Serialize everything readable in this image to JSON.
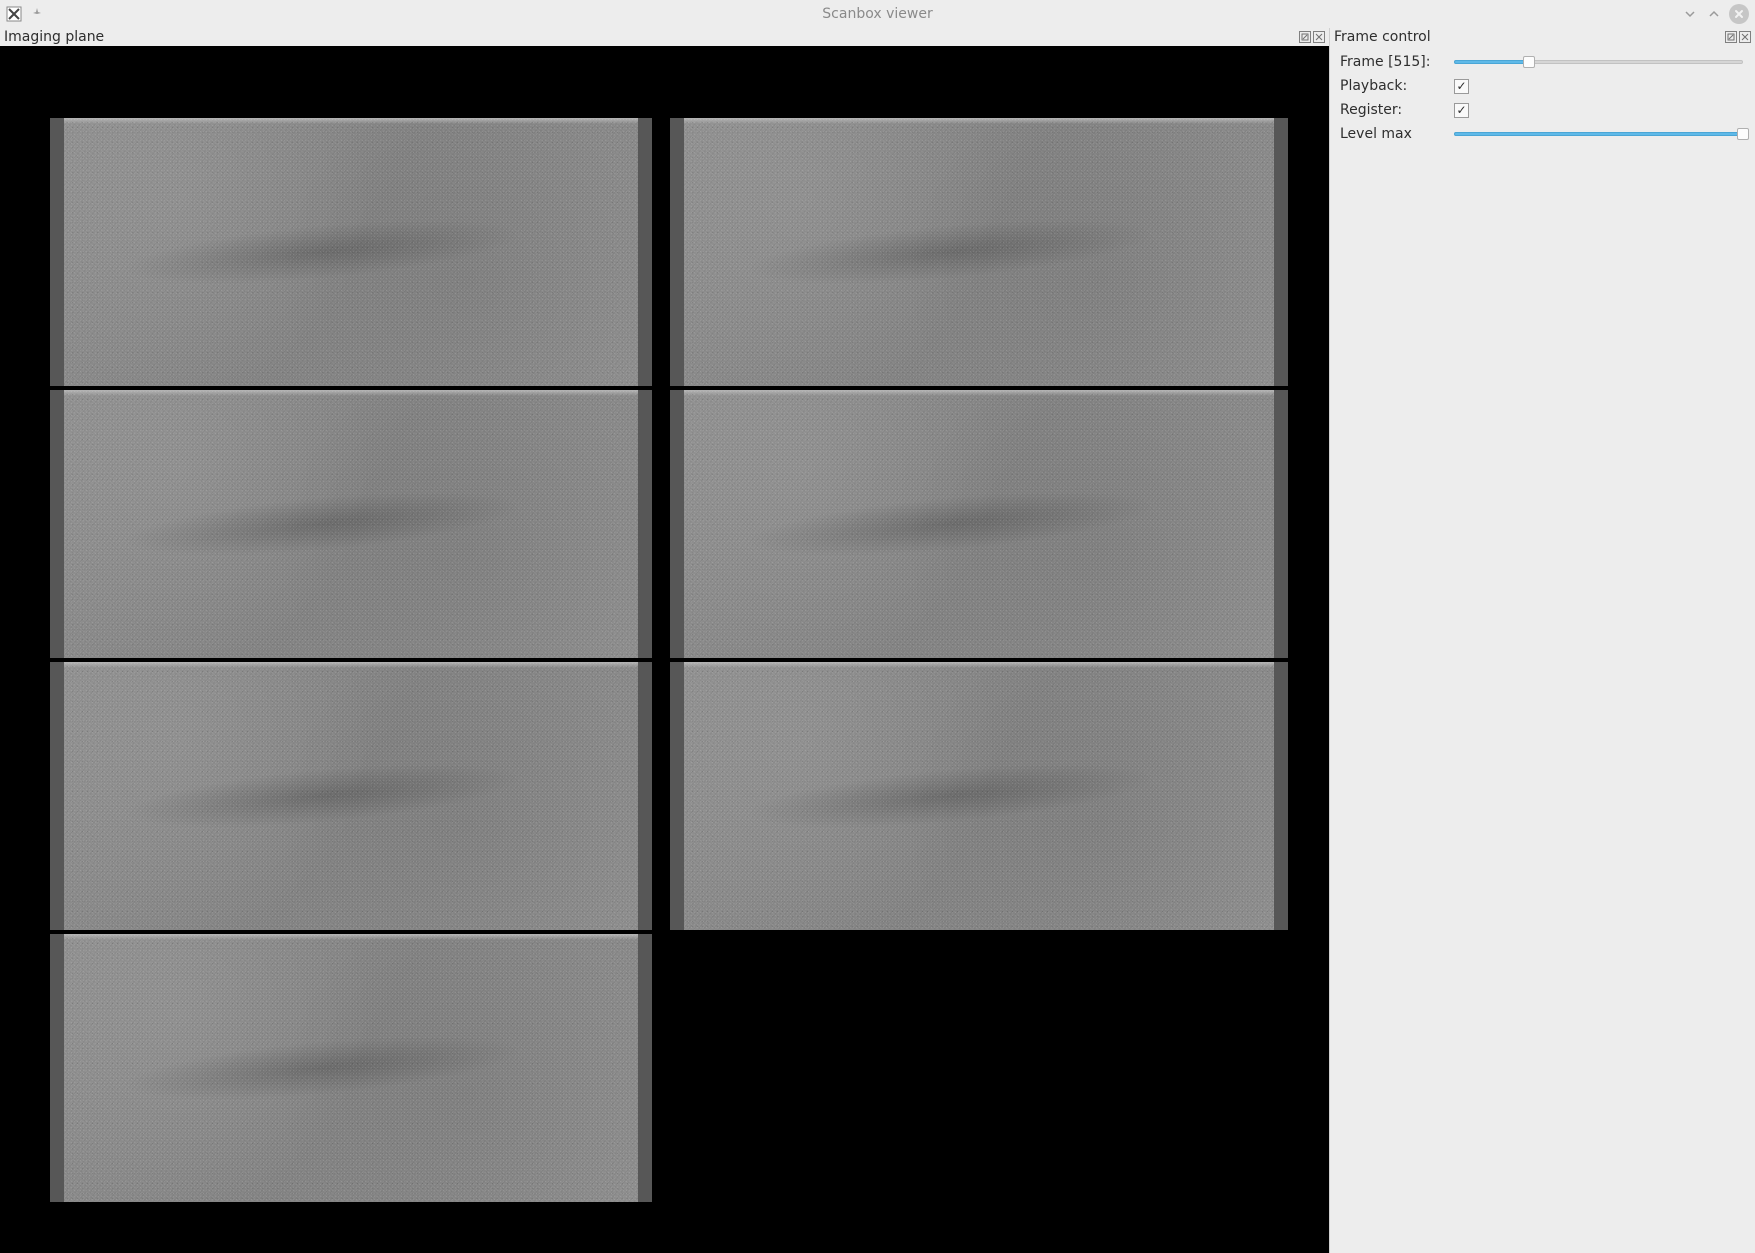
{
  "window": {
    "title": "Scanbox viewer"
  },
  "panels": {
    "imaging": {
      "title": "Imaging plane"
    },
    "control": {
      "title": "Frame control"
    }
  },
  "controls": {
    "frame": {
      "label": "Frame [515]:",
      "value": 515,
      "min": 0,
      "max": 2000,
      "percent": 26
    },
    "playback": {
      "label": "Playback:",
      "checked": true
    },
    "register": {
      "label": "Register:",
      "checked": true
    },
    "levelmax": {
      "label": "Level max",
      "value": 100,
      "percent": 100
    }
  },
  "imaging": {
    "rows": 4,
    "cols": 2,
    "tiles_present": [
      true,
      true,
      true,
      true,
      true,
      true,
      true,
      false
    ]
  },
  "icons": {
    "app": "X",
    "pin": "pin",
    "chev_down": "v",
    "chev_up": "^",
    "close": "x",
    "pop": "⧉",
    "dock_close": "✕"
  }
}
